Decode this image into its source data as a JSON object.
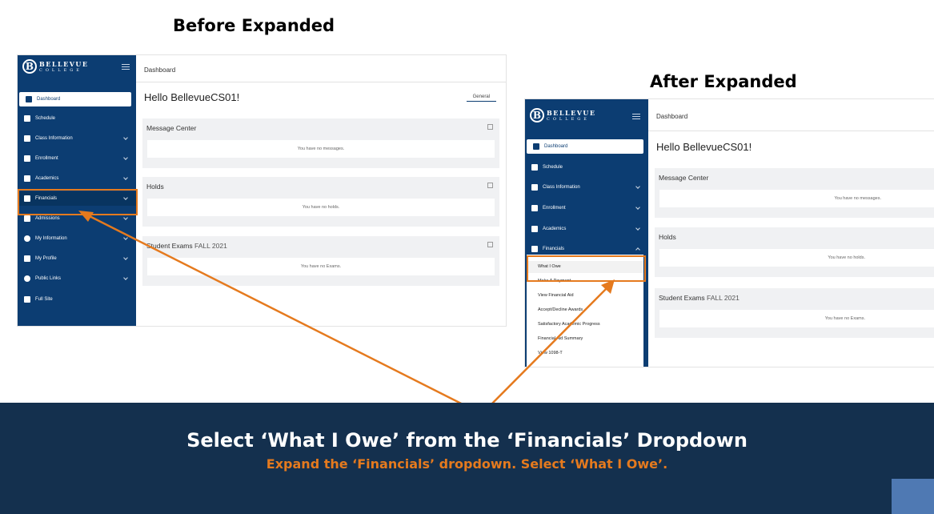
{
  "headings": {
    "before": "Before Expanded",
    "after": "After Expanded"
  },
  "brand": {
    "name": "BELLEVUE",
    "sub": "COLLEGE"
  },
  "nav": [
    {
      "label": "Dashboard",
      "icon": "home-icon"
    },
    {
      "label": "Schedule",
      "icon": "calendar-icon"
    },
    {
      "label": "Class Information",
      "icon": "list-icon"
    },
    {
      "label": "Enrollment",
      "icon": "graduation-cap-icon"
    },
    {
      "label": "Academics",
      "icon": "books-icon"
    },
    {
      "label": "Financials",
      "icon": "credit-card-icon"
    },
    {
      "label": "Admissions",
      "icon": "id-card-icon"
    },
    {
      "label": "My Information",
      "icon": "info-icon"
    },
    {
      "label": "My Profile",
      "icon": "user-icon"
    },
    {
      "label": "Public Links",
      "icon": "globe-icon"
    },
    {
      "label": "Full Site",
      "icon": "window-icon"
    }
  ],
  "financials_submenu": [
    "What I Owe",
    "Make A Payment",
    "View Financial Aid",
    "Accept/Decline Awards",
    "Satisfactory Academic Progress",
    "Financial Aid Summary",
    "View 1098-T"
  ],
  "dashboard": {
    "breadcrumb": "Dashboard",
    "greeting": "Hello BellevueCS01!",
    "tab": "General",
    "cards": [
      {
        "title": "Message Center",
        "term": "",
        "body": "You have no messages."
      },
      {
        "title": "Holds",
        "term": "",
        "body": "You have no holds."
      },
      {
        "title": "Student Exams",
        "term": "FALL 2021",
        "body": "You have no Exams."
      }
    ]
  },
  "caption": {
    "main": "Select ‘What I Owe’ from the ‘Financials’ Dropdown",
    "sub": "Expand the ‘Financials’ dropdown. Select ‘What I Owe’."
  },
  "colors": {
    "navy": "#0c3d72",
    "highlight": "#e57a1e",
    "footer": "#14304e",
    "accent_square": "#4f79b3"
  }
}
